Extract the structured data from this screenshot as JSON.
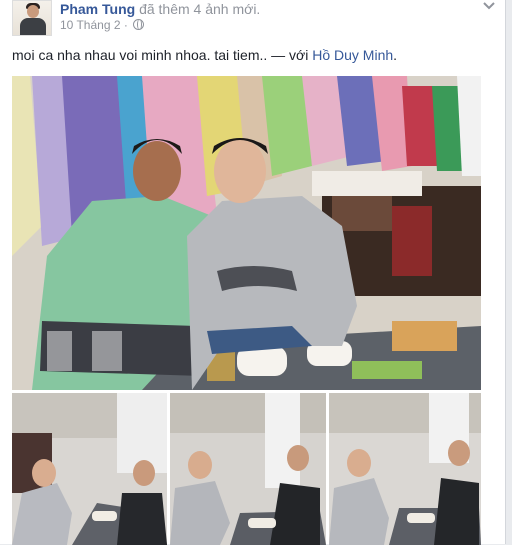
{
  "post": {
    "author": "Pham Tung",
    "action": " đã thêm 4 ảnh mới.",
    "date": "10 Tháng 2 · ",
    "privacy_icon": "globe-icon",
    "options_icon": "chevron-down-icon",
    "text": "moi ca nha nhau voi minh nhoa. tai tiem.. — với ",
    "tagged": "Hồ Duy Minh",
    "end": "."
  },
  "photos": {
    "main": "group photo",
    "thumbnails": [
      "thumb 1",
      "thumb 2",
      "thumb 3"
    ]
  },
  "colors": {
    "link": "#365899",
    "meta": "#90949c",
    "text": "#1d2129"
  }
}
